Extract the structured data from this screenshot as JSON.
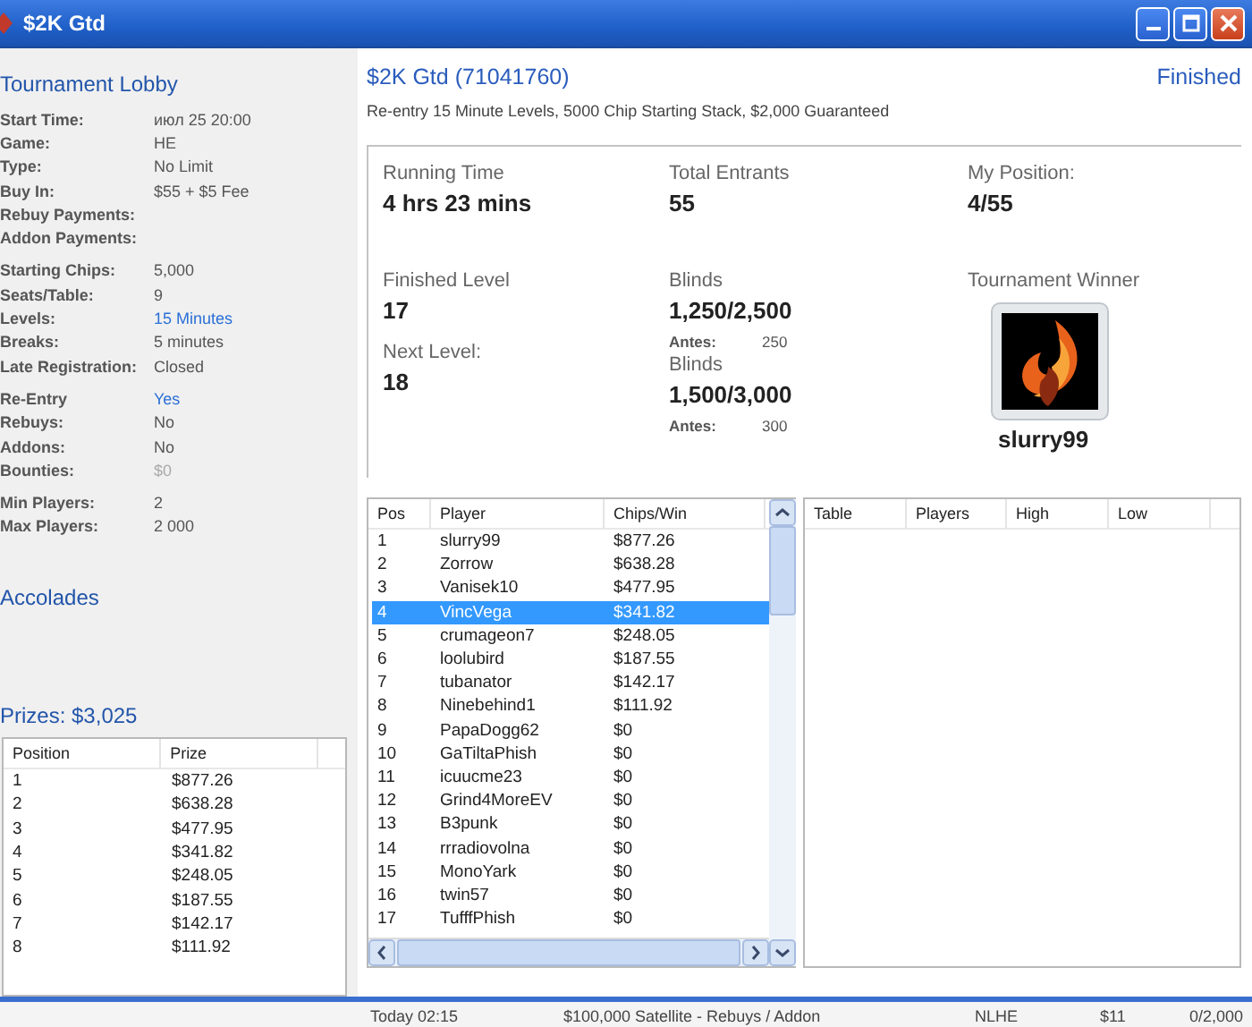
{
  "window": {
    "title": "$2K Gtd"
  },
  "lobby": {
    "heading": "Tournament Lobby",
    "groups": [
      [
        {
          "label": "Start Time:",
          "value": "июл 25 20:00",
          "kind": "plain"
        },
        {
          "label": "Game:",
          "value": "HE",
          "kind": "plain"
        },
        {
          "label": "Type:",
          "value": "No Limit",
          "kind": "plain"
        },
        {
          "label": "Buy In:",
          "value": "$55 + $5 Fee",
          "kind": "plain"
        },
        {
          "label": "Rebuy Payments:"
        },
        {
          "label": "Addon Payments:"
        }
      ],
      [
        {
          "label": "Starting Chips:",
          "value": "5,000",
          "kind": "plain"
        },
        {
          "label": "Seats/Table:",
          "value": "9",
          "kind": "plain"
        },
        {
          "label": "Levels:",
          "value": "15 Minutes",
          "kind": "link"
        },
        {
          "label": "Breaks:",
          "value": "5 minutes",
          "kind": "plain"
        },
        {
          "label": "Late Registration:",
          "value": "Closed",
          "kind": "plain"
        }
      ],
      [
        {
          "label": "Re-Entry",
          "value": "Yes",
          "kind": "link"
        },
        {
          "label": "Rebuys:",
          "value": "No",
          "kind": "plain"
        },
        {
          "label": "Addons:",
          "value": "No",
          "kind": "plain"
        },
        {
          "label": "Bounties:",
          "value": "$0",
          "kind": "muted"
        }
      ],
      [
        {
          "label": "Min Players:",
          "value": "2",
          "kind": "plain"
        },
        {
          "label": "Max Players:",
          "value": "2 000",
          "kind": "plain"
        }
      ]
    ],
    "accolades": "Accolades",
    "prizes_heading": "Prizes: $3,025",
    "prize_table": {
      "columns": [
        "Position",
        "Prize"
      ],
      "rows": [
        [
          "1",
          "$877.26"
        ],
        [
          "2",
          "$638.28"
        ],
        [
          "3",
          "$477.95"
        ],
        [
          "4",
          "$341.82"
        ],
        [
          "5",
          "$248.05"
        ],
        [
          "6",
          "$187.55"
        ],
        [
          "7",
          "$142.17"
        ],
        [
          "8",
          "$111.92"
        ]
      ]
    }
  },
  "tournament": {
    "title": "$2K Gtd (71041760)",
    "status": "Finished",
    "description": "Re-entry 15 Minute Levels, 5000 Chip Starting Stack, $2,000 Guaranteed",
    "stats": {
      "running_time": {
        "label": "Running Time",
        "value": "4 hrs 23 mins"
      },
      "total_entrants": {
        "label": "Total Entrants",
        "value": "55"
      },
      "my_position": {
        "label": "My Position:",
        "value": "4/55"
      },
      "finished_level": {
        "label": "Finished Level",
        "value": "17"
      },
      "blinds": {
        "label": "Blinds",
        "value": "1,250/2,500",
        "antes_label": "Antes:",
        "antes": "250"
      },
      "next_level": {
        "label": "Next Level:",
        "value": "18"
      },
      "next_blinds": {
        "label": "Blinds",
        "value": "1,500/3,000",
        "antes_label": "Antes:",
        "antes": "300"
      },
      "winner": {
        "label": "Tournament Winner",
        "name": "slurry99"
      }
    }
  },
  "players": {
    "columns": [
      "Pos",
      "Player",
      "Chips/Win"
    ],
    "rows": [
      {
        "cells": [
          "1",
          "slurry99",
          "$877.26"
        ],
        "selected": false
      },
      {
        "cells": [
          "2",
          "Zorrow",
          "$638.28"
        ],
        "selected": false
      },
      {
        "cells": [
          "3",
          "Vanisek10",
          "$477.95"
        ],
        "selected": false
      },
      {
        "cells": [
          "4",
          "VincVega",
          "$341.82"
        ],
        "selected": true
      },
      {
        "cells": [
          "5",
          "crumageon7",
          "$248.05"
        ],
        "selected": false
      },
      {
        "cells": [
          "6",
          "loolubird",
          "$187.55"
        ],
        "selected": false
      },
      {
        "cells": [
          "7",
          "tubanator",
          "$142.17"
        ],
        "selected": false
      },
      {
        "cells": [
          "8",
          "Ninebehind1",
          "$111.92"
        ],
        "selected": false
      },
      {
        "cells": [
          "9",
          "PapaDogg62",
          "$0"
        ],
        "selected": false
      },
      {
        "cells": [
          "10",
          "GaTiltaPhish",
          "$0"
        ],
        "selected": false
      },
      {
        "cells": [
          "11",
          "icuucme23",
          "$0"
        ],
        "selected": false
      },
      {
        "cells": [
          "12",
          "Grind4MoreEV",
          "$0"
        ],
        "selected": false
      },
      {
        "cells": [
          "13",
          "B3punk",
          "$0"
        ],
        "selected": false
      },
      {
        "cells": [
          "14",
          "rrradiovolna",
          "$0"
        ],
        "selected": false
      },
      {
        "cells": [
          "15",
          "MonoYark",
          "$0"
        ],
        "selected": false
      },
      {
        "cells": [
          "16",
          "twin57",
          "$0"
        ],
        "selected": false
      },
      {
        "cells": [
          "17",
          "TufffPhish",
          "$0"
        ],
        "selected": false
      }
    ]
  },
  "tables": {
    "columns": [
      "Table",
      "Players",
      "High",
      "Low"
    ]
  },
  "background_row": {
    "time": "Today 02:15",
    "name": "$100,000 Satellite - Rebuys / Addon",
    "game": "NLHE",
    "buy_in": "$11",
    "entrants": "0/2,000"
  }
}
